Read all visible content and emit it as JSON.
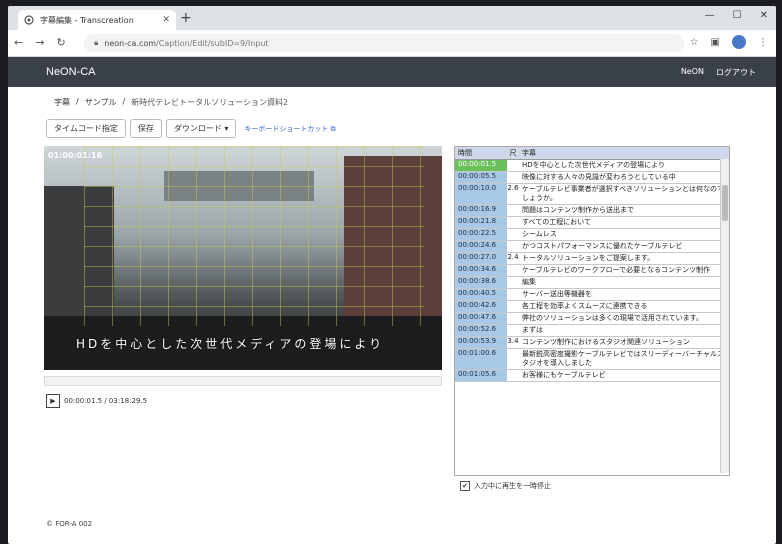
{
  "browser": {
    "tab_title": "字幕編集 - Transcreation",
    "url_host": "neon-ca.com",
    "url_path": "/Caption/Edit/subID=9/Input"
  },
  "app": {
    "brand": "NeON-CA",
    "nav_neon": "NeON",
    "nav_logout": "ログアウト"
  },
  "breadcrumb": {
    "item1": "字幕",
    "sep": "/",
    "item2": "サンプル",
    "item3": "新時代テレビトータルソリューション資料2"
  },
  "toolbar": {
    "timecode_label": "タイムコード指定",
    "save_label": "保存",
    "download_label": "ダウンロード",
    "shortcut_label": "キーボードショートカット"
  },
  "video": {
    "timecode": "01:00:01:16",
    "subtitle": "HDを中心とした次世代メディアの登場により",
    "time_display": "00:00:01.5 / 03:18:29.5"
  },
  "captions": {
    "headers": [
      "時間",
      "尺",
      "字幕"
    ],
    "rows": [
      {
        "time": "00:00:01.5",
        "dur": "",
        "text": "HDを中心とした次世代メディアの登場により",
        "hl": true
      },
      {
        "time": "00:00:05.5",
        "dur": "",
        "text": "映像に対する人々の見識が変わろうとしている中"
      },
      {
        "time": "00:00:10.0",
        "dur": "2.6",
        "text": "ケーブルテレビ事業者が選択すべきソリューションとは何なのでしょうか。"
      },
      {
        "time": "00:00:16.9",
        "dur": "",
        "text": "問題はコンテンツ制作から送出まで"
      },
      {
        "time": "00:00:21.8",
        "dur": "",
        "text": "すべての工程において"
      },
      {
        "time": "00:00:22.5",
        "dur": "",
        "text": "シームレス"
      },
      {
        "time": "00:00:24.6",
        "dur": "",
        "text": "かつコストパフォーマンスに優れたケーブルテレビ"
      },
      {
        "time": "00:00:27.0",
        "dur": "2.4",
        "text": "トータルソリューションをご提案します。"
      },
      {
        "time": "00:00:34.6",
        "dur": "",
        "text": "ケーブルテレビのワークフローで必要となるコンテンツ制作"
      },
      {
        "time": "00:00:38.6",
        "dur": "",
        "text": "編集"
      },
      {
        "time": "00:00:40.5",
        "dur": "",
        "text": "サーバー送出等機器を"
      },
      {
        "time": "00:00:42.6",
        "dur": "",
        "text": "各工程を効率よくスムーズに連携できる"
      },
      {
        "time": "00:00:47.6",
        "dur": "",
        "text": "弊社のソリューションは多くの現場で活用されています。"
      },
      {
        "time": "00:00:52.6",
        "dur": "",
        "text": "まずは"
      },
      {
        "time": "00:00:53.9",
        "dur": "3.4",
        "text": "コンテンツ制作におけるスタジオ関連ソリューション"
      },
      {
        "time": "00:01:00.6",
        "dur": "",
        "text": "最新鋭高密度撮影ケーブルテレビではスリーディーバーチャルスタジオを導入しました"
      },
      {
        "time": "00:01:05.6",
        "dur": "",
        "text": "お客様にもケーブルテレビ"
      }
    ]
  },
  "options": {
    "pause_on_input": "入力中に再生を一時停止"
  },
  "footer": {
    "copyright": "© FOR-A 002"
  }
}
